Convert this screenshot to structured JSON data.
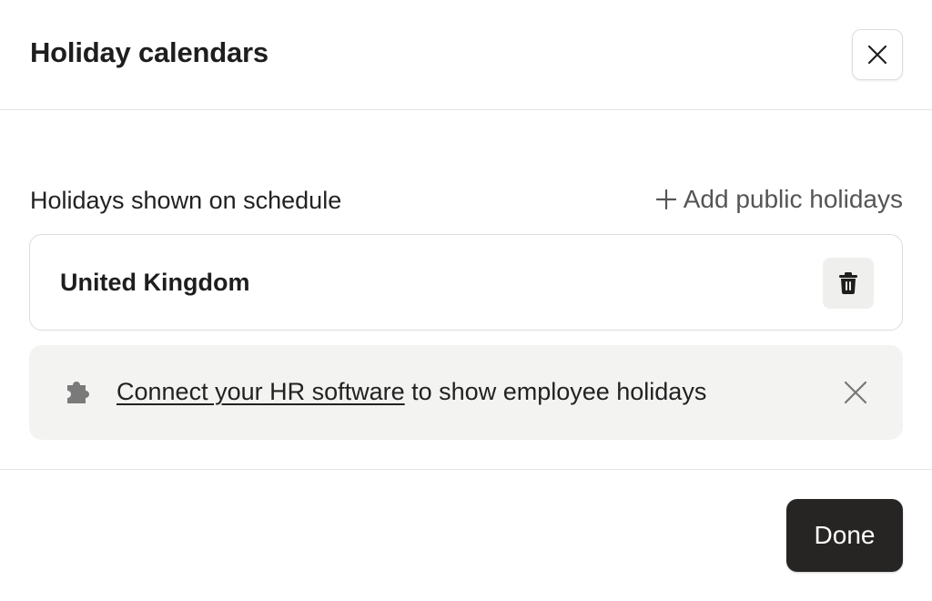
{
  "dialog": {
    "title": "Holiday calendars"
  },
  "section": {
    "label": "Holidays shown on schedule",
    "add_label": "Add public holidays"
  },
  "holidays": [
    {
      "name": "United Kingdom"
    }
  ],
  "hr_banner": {
    "link_text": "Connect your HR software",
    "rest_text": " to show employee holidays"
  },
  "footer": {
    "done_label": "Done"
  },
  "icons": {
    "close": "close-icon",
    "add": "plus-icon",
    "delete": "trash-icon",
    "integration": "puzzle-icon",
    "dismiss": "close-icon"
  },
  "colors": {
    "primary_button": "#262524",
    "banner_bg": "#f3f3f2",
    "border": "#dcdcdc"
  }
}
